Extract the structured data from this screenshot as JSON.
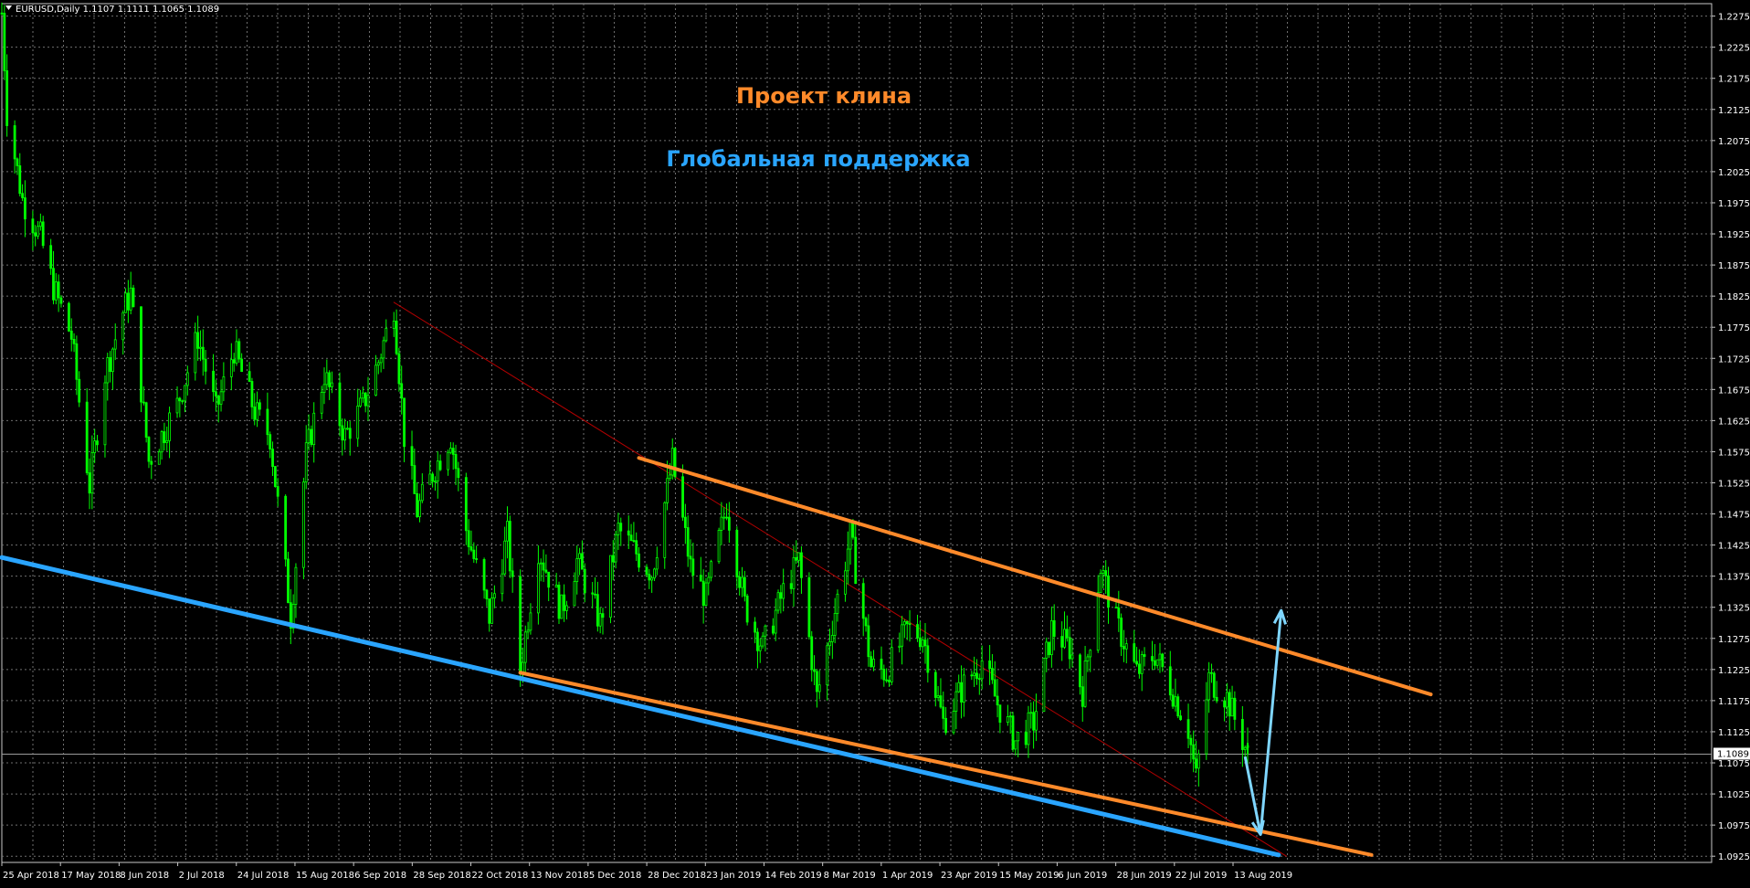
{
  "window": {
    "header": "EURUSD,Daily  1.1107 1.1111 1.1065 1.1089"
  },
  "colors": {
    "background": "#000000",
    "grid": "#6f6f6f",
    "candle": "#00ff00",
    "wedge": "#ff8a2a",
    "support": "#2aa5ff",
    "trend_red": "#b30000",
    "forecast_arrow": "#7fd6ff"
  },
  "annotations": {
    "wedge_label": "Проект клина",
    "support_label": "Глобальная поддержка"
  },
  "price_axis": {
    "labels": [
      "1.2275",
      "1.2225",
      "1.2175",
      "1.2125",
      "1.2075",
      "1.2025",
      "1.1975",
      "1.1925",
      "1.1875",
      "1.1825",
      "1.1775",
      "1.1725",
      "1.1675",
      "1.1625",
      "1.1575",
      "1.1525",
      "1.1475",
      "1.1425",
      "1.1375",
      "1.1325",
      "1.1275",
      "1.1225",
      "1.1175",
      "1.1125",
      "1.1075",
      "1.1025",
      "1.0975",
      "1.0925"
    ],
    "current_price": "1.1089"
  },
  "time_axis": {
    "labels": [
      "25 Apr 2018",
      "17 May 2018",
      "8 Jun 2018",
      "2 Jul 2018",
      "24 Jul 2018",
      "15 Aug 2018",
      "6 Sep 2018",
      "28 Sep 2018",
      "22 Oct 2018",
      "13 Nov 2018",
      "5 Dec 2018",
      "28 Dec 2018",
      "23 Jan 2019",
      "14 Feb 2019",
      "8 Mar 2019",
      "1 Apr 2019",
      "23 Apr 2019",
      "15 May 2019",
      "6 Jun 2019",
      "28 Jun 2019",
      "22 Jul 2019",
      "13 Aug 2019"
    ]
  },
  "chart_data": {
    "type": "candlestick",
    "symbol": "EURUSD",
    "timeframe": "Daily",
    "last_bar": {
      "open": 1.1107,
      "high": 1.1111,
      "low": 1.1065,
      "close": 1.1089
    },
    "ylim": [
      1.0915,
      1.2295
    ],
    "x_range": [
      "2018-04-25",
      "2019-08-21"
    ],
    "price_path": [
      [
        "2018-04-25",
        1.228
      ],
      [
        "2018-04-27",
        1.212
      ],
      [
        "2018-05-03",
        1.198
      ],
      [
        "2018-05-10",
        1.192
      ],
      [
        "2018-05-15",
        1.184
      ],
      [
        "2018-05-22",
        1.176
      ],
      [
        "2018-05-29",
        1.152
      ],
      [
        "2018-06-04",
        1.17
      ],
      [
        "2018-06-11",
        1.18
      ],
      [
        "2018-06-14",
        1.183
      ],
      [
        "2018-06-21",
        1.156
      ],
      [
        "2018-07-02",
        1.165
      ],
      [
        "2018-07-10",
        1.176
      ],
      [
        "2018-07-17",
        1.164
      ],
      [
        "2018-07-24",
        1.174
      ],
      [
        "2018-08-01",
        1.164
      ],
      [
        "2018-08-07",
        1.16
      ],
      [
        "2018-08-15",
        1.131
      ],
      [
        "2018-08-21",
        1.157
      ],
      [
        "2018-08-28",
        1.17
      ],
      [
        "2018-09-05",
        1.16
      ],
      [
        "2018-09-12",
        1.165
      ],
      [
        "2018-09-18",
        1.172
      ],
      [
        "2018-09-24",
        1.181
      ],
      [
        "2018-09-28",
        1.16
      ],
      [
        "2018-10-03",
        1.148
      ],
      [
        "2018-10-10",
        1.155
      ],
      [
        "2018-10-16",
        1.16
      ],
      [
        "2018-10-22",
        1.145
      ],
      [
        "2018-10-31",
        1.131
      ],
      [
        "2018-11-07",
        1.144
      ],
      [
        "2018-11-12",
        1.1225
      ],
      [
        "2018-11-19",
        1.142
      ],
      [
        "2018-11-28",
        1.132
      ],
      [
        "2018-12-04",
        1.14
      ],
      [
        "2018-12-13",
        1.13
      ],
      [
        "2018-12-20",
        1.145
      ],
      [
        "2019-01-02",
        1.138
      ],
      [
        "2019-01-10",
        1.156
      ],
      [
        "2019-01-17",
        1.139
      ],
      [
        "2019-01-23",
        1.134
      ],
      [
        "2019-01-31",
        1.149
      ],
      [
        "2019-02-07",
        1.133
      ],
      [
        "2019-02-14",
        1.126
      ],
      [
        "2019-02-22",
        1.135
      ],
      [
        "2019-02-28",
        1.14
      ],
      [
        "2019-03-07",
        1.118
      ],
      [
        "2019-03-14",
        1.132
      ],
      [
        "2019-03-20",
        1.144
      ],
      [
        "2019-03-28",
        1.123
      ],
      [
        "2019-04-03",
        1.122
      ],
      [
        "2019-04-11",
        1.129
      ],
      [
        "2019-04-17",
        1.128
      ],
      [
        "2019-04-25",
        1.114
      ],
      [
        "2019-05-03",
        1.12
      ],
      [
        "2019-05-10",
        1.124
      ],
      [
        "2019-05-16",
        1.117
      ],
      [
        "2019-05-23",
        1.111
      ],
      [
        "2019-05-30",
        1.114
      ],
      [
        "2019-06-06",
        1.129
      ],
      [
        "2019-06-13",
        1.126
      ],
      [
        "2019-06-18",
        1.119
      ],
      [
        "2019-06-25",
        1.139
      ],
      [
        "2019-07-01",
        1.13
      ],
      [
        "2019-07-09",
        1.122
      ],
      [
        "2019-07-16",
        1.125
      ],
      [
        "2019-07-22",
        1.12
      ],
      [
        "2019-07-29",
        1.113
      ],
      [
        "2019-08-01",
        1.105
      ],
      [
        "2019-08-06",
        1.121
      ],
      [
        "2019-08-13",
        1.118
      ],
      [
        "2019-08-21",
        1.1089
      ]
    ],
    "lines": [
      {
        "role": "wedge-upper",
        "from": [
          "2018-12-28",
          1.1565
        ],
        "to": [
          "2019-10-31",
          1.1185
        ]
      },
      {
        "role": "wedge-lower",
        "from": [
          "2018-11-12",
          1.122
        ],
        "to": [
          "2019-10-08",
          1.0927
        ]
      },
      {
        "role": "global-support",
        "from": [
          "2018-04-25",
          1.1405
        ],
        "to": [
          "2019-09-02",
          1.0927
        ]
      },
      {
        "role": "trend-red",
        "from": [
          "2018-09-24",
          1.1815
        ],
        "to": [
          "2019-09-05",
          1.0925
        ]
      }
    ],
    "forecast": [
      [
        "2019-08-20",
        1.1085
      ],
      [
        "2019-08-26",
        1.096
      ],
      [
        "2019-09-03",
        1.132
      ]
    ]
  }
}
